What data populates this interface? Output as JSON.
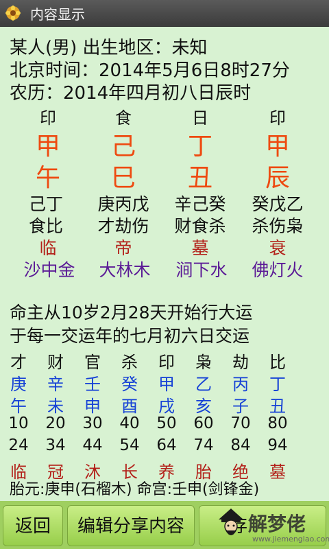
{
  "title_bar": {
    "title": "内容显示",
    "icon": "flower-icon"
  },
  "header_lines": [
    "某人(男) 出生地区：未知",
    "北京时间：2014年5月6日8时27分",
    "农历：2014年四月初八日辰时"
  ],
  "pillars": {
    "gods": [
      "印",
      "食",
      "日",
      "印"
    ],
    "stems": [
      "甲",
      "己",
      "丁",
      "甲"
    ],
    "branches": [
      "午",
      "巳",
      "丑",
      "辰"
    ],
    "hidden_stems": [
      "己丁",
      "庚丙戊",
      "辛己癸",
      "癸戊乙"
    ],
    "hidden_gods": [
      "食比",
      "才劫伤",
      "财食杀",
      "杀伤枭"
    ],
    "life_stages": [
      "临",
      "帝",
      "墓",
      "衰"
    ],
    "nayin": [
      "沙中金",
      "大林木",
      "涧下水",
      "佛灯火"
    ]
  },
  "luck": {
    "line1": "命主从10岁2月28天开始行大运",
    "line2": "于每一交运年的七月初六日交运",
    "gods": [
      "才",
      "财",
      "官",
      "杀",
      "印",
      "枭",
      "劫",
      "比"
    ],
    "stems": [
      "庚",
      "辛",
      "壬",
      "癸",
      "甲",
      "乙",
      "丙",
      "丁"
    ],
    "branches": [
      "午",
      "未",
      "申",
      "酉",
      "戌",
      "亥",
      "子",
      "丑"
    ],
    "ages": [
      "10",
      "20",
      "30",
      "40",
      "50",
      "60",
      "70",
      "80"
    ],
    "years": [
      "24",
      "34",
      "44",
      "54",
      "64",
      "74",
      "84",
      "94"
    ],
    "stages": [
      "临",
      "冠",
      "沐",
      "长",
      "养",
      "胎",
      "绝",
      "墓"
    ],
    "footer": "胎元:庚申(石榴木) 命宫:壬申(剑锋金)"
  },
  "bottom_bar": {
    "back_label": "返回",
    "edit_share_label": "编辑分享内容",
    "save_label_partial": "存",
    "watermark_text": "解梦佬",
    "watermark_url": "www.jiemenglao.com"
  }
}
